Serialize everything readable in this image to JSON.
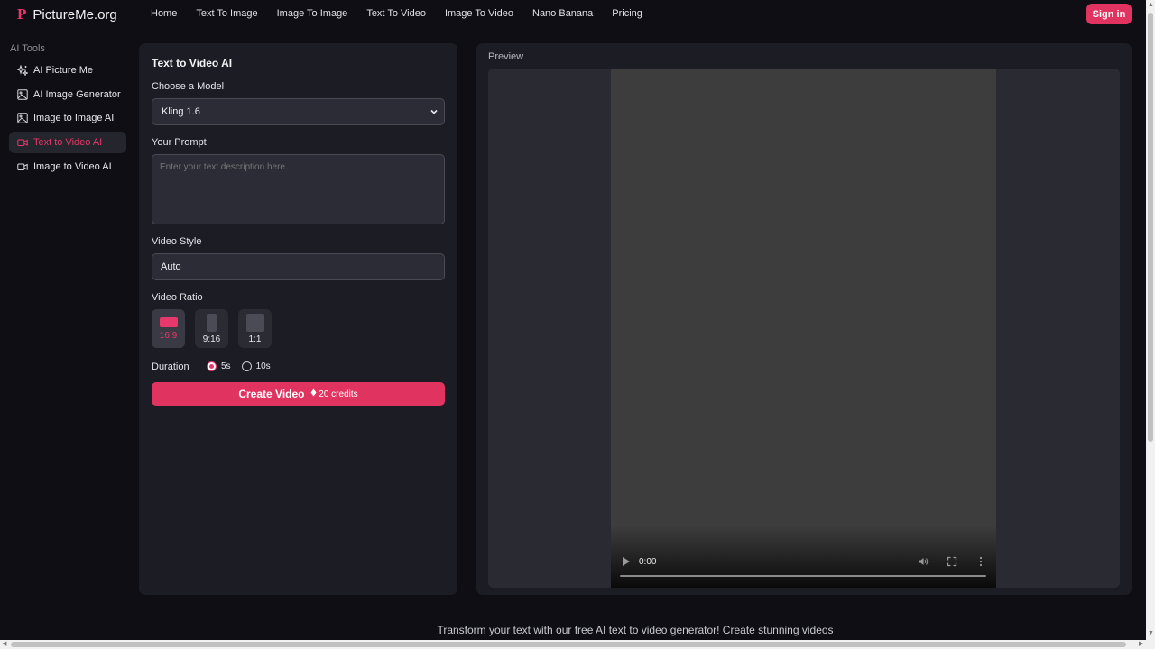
{
  "brand": {
    "mark": "P",
    "name": "PictureMe.org"
  },
  "nav": {
    "links": [
      "Home",
      "Text To Image",
      "Image To Image",
      "Text To Video",
      "Image To Video",
      "Nano Banana",
      "Pricing"
    ],
    "signin_label": "Sign in"
  },
  "sidebar": {
    "heading": "AI Tools",
    "items": [
      {
        "label": "AI Picture Me",
        "icon": "sparkles-icon",
        "active": false
      },
      {
        "label": "AI Image Generator",
        "icon": "image-icon",
        "active": false
      },
      {
        "label": "Image to Image AI",
        "icon": "image-icon",
        "active": false
      },
      {
        "label": "Text to Video AI",
        "icon": "video-icon",
        "active": true
      },
      {
        "label": "Image to Video AI",
        "icon": "video-icon",
        "active": false
      }
    ]
  },
  "form": {
    "title": "Text to Video AI",
    "model_label": "Choose a Model",
    "model_value": "Kling 1.6",
    "prompt_label": "Your Prompt",
    "prompt_placeholder": "Enter your text description here...",
    "style_label": "Video Style",
    "style_value": "Auto",
    "ratio_label": "Video Ratio",
    "ratios": [
      {
        "label": "16:9",
        "active": true
      },
      {
        "label": "9:16",
        "active": false
      },
      {
        "label": "1:1",
        "active": false
      }
    ],
    "duration_label": "Duration",
    "durations": [
      {
        "label": "5s",
        "checked": true
      },
      {
        "label": "10s",
        "checked": false
      }
    ],
    "create_label": "Create Video",
    "credits_label": "20 credits"
  },
  "preview": {
    "label": "Preview",
    "video_time": "0:00"
  },
  "footer": {
    "tagline": "Transform your text with our free AI text to video generator! Create stunning videos"
  },
  "colors": {
    "accent": "#e0335f",
    "background": "#0e0e14",
    "panel": "#1c1c25"
  }
}
